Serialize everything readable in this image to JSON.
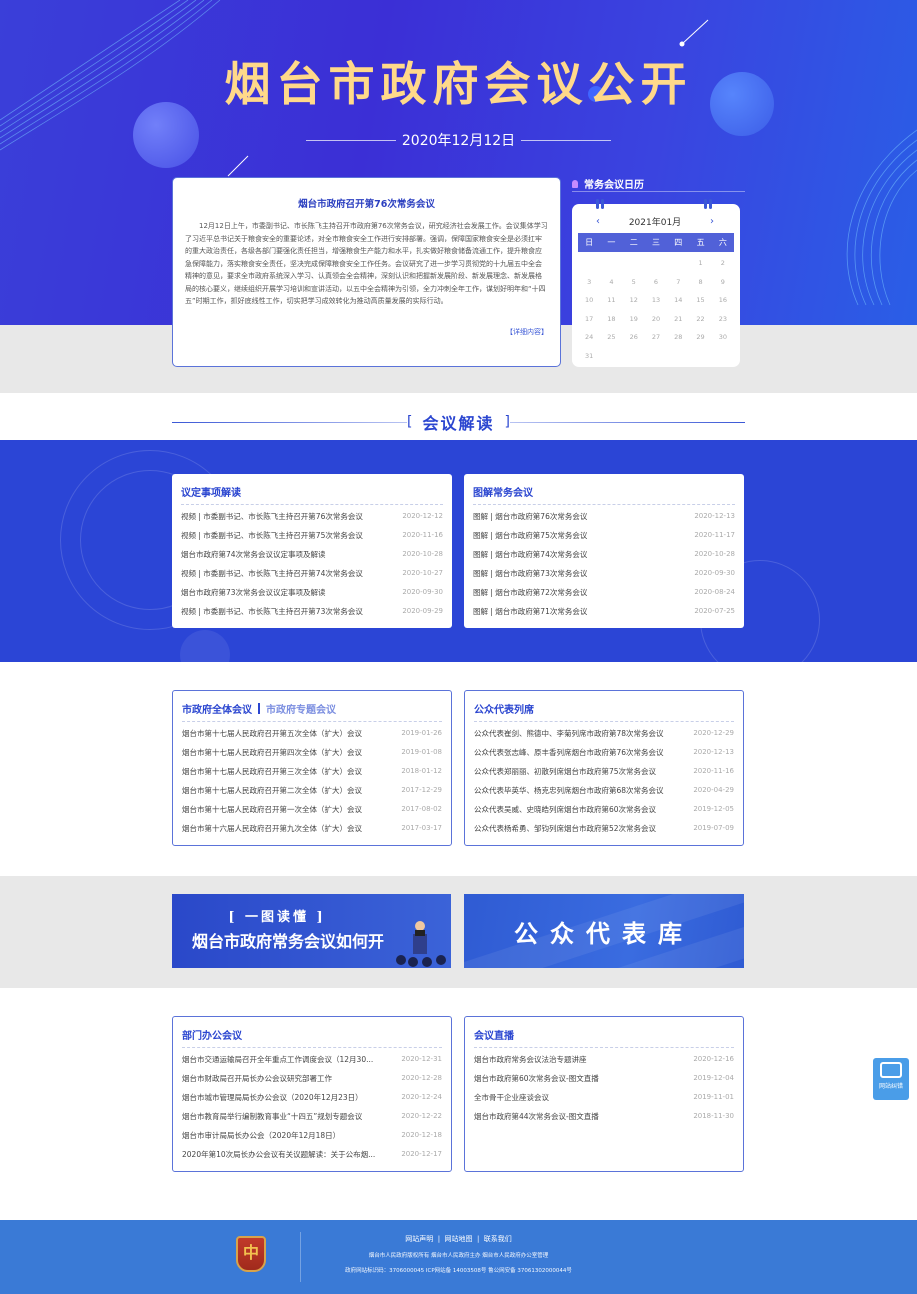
{
  "hero": {
    "title": "烟台市政府会议公开",
    "date": "2020年12月12日"
  },
  "feature": {
    "headline": "烟台市政府召开第76次常务会议",
    "body": "12月12日上午，市委副书记、市长陈飞主持召开市政府第76次常务会议，研究经济社会发展工作。会议集体学习了习近平总书记关于粮食安全的重要论述，对全市粮食安全工作进行安排部署。强调，保障国家粮食安全是必须扛牢的重大政治责任，各级各部门要强化责任担当，增强粮食生产能力和水平，扎实做好粮食储备流通工作，提升粮食应急保障能力，落实粮食安全责任，坚决完成保障粮食安全工作任务。会议研究了进一步学习贯彻党的十九届五中全会精神的意见，要求全市政府系统深入学习、认真领会全会精神，深刻认识和把握新发展阶段、新发展理念、新发展格局的核心要义，继续组织开展学习培训和宣讲活动，以五中全会精神为引领，全力冲刺全年工作，谋划好明年和“十四五”时期工作，抓好底线性工作，切实把学习成效转化为推动高质量发展的实际行动。",
    "more": "【详细内容】"
  },
  "calendar": {
    "heading": "常务会议日历",
    "month": "2021年01月",
    "prev": "‹",
    "next": "›",
    "weekdays": [
      "日",
      "一",
      "二",
      "三",
      "四",
      "五",
      "六"
    ],
    "days": [
      "",
      "",
      "",
      "",
      "",
      "1",
      "2",
      "3",
      "4",
      "5",
      "6",
      "7",
      "8",
      "9",
      "10",
      "11",
      "12",
      "13",
      "14",
      "15",
      "16",
      "17",
      "18",
      "19",
      "20",
      "21",
      "22",
      "23",
      "24",
      "25",
      "26",
      "27",
      "28",
      "29",
      "30",
      "31"
    ]
  },
  "section_title": "会议解读",
  "interpretation": {
    "title": "议定事项解读",
    "items": [
      {
        "t": "视频 | 市委副书记、市长陈飞主持召开第76次常务会议",
        "d": "2020-12-12"
      },
      {
        "t": "视频 | 市委副书记、市长陈飞主持召开第75次常务会议",
        "d": "2020-11-16"
      },
      {
        "t": "烟台市政府第74次常务会议议定事项及解读",
        "d": "2020-10-28"
      },
      {
        "t": "视频 | 市委副书记、市长陈飞主持召开第74次常务会议",
        "d": "2020-10-27"
      },
      {
        "t": "烟台市政府第73次常务会议议定事项及解读",
        "d": "2020-09-30"
      },
      {
        "t": "视频 | 市委副书记、市长陈飞主持召开第73次常务会议",
        "d": "2020-09-29"
      }
    ]
  },
  "graphic": {
    "title": "图解常务会议",
    "items": [
      {
        "t": "图解 | 烟台市政府第76次常务会议",
        "d": "2020-12-13"
      },
      {
        "t": "图解 | 烟台市政府第75次常务会议",
        "d": "2020-11-17"
      },
      {
        "t": "图解 | 烟台市政府第74次常务会议",
        "d": "2020-10-28"
      },
      {
        "t": "图解 | 烟台市政府第73次常务会议",
        "d": "2020-09-30"
      },
      {
        "t": "图解 | 烟台市政府第72次常务会议",
        "d": "2020-08-24"
      },
      {
        "t": "图解 | 烟台市政府第71次常务会议",
        "d": "2020-07-25"
      }
    ]
  },
  "plenary": {
    "tab_active": "市政府全体会议",
    "tab_other": "市政府专题会议",
    "items": [
      {
        "t": "烟台市第十七届人民政府召开第五次全体（扩大）会议",
        "d": "2019-01-26"
      },
      {
        "t": "烟台市第十七届人民政府召开第四次全体（扩大）会议",
        "d": "2019-01-08"
      },
      {
        "t": "烟台市第十七届人民政府召开第三次全体（扩大）会议",
        "d": "2018-01-12"
      },
      {
        "t": "烟台市第十七届人民政府召开第二次全体（扩大）会议",
        "d": "2017-12-29"
      },
      {
        "t": "烟台市第十七届人民政府召开第一次全体（扩大）会议",
        "d": "2017-08-02"
      },
      {
        "t": "烟台市第十六届人民政府召开第九次全体（扩大）会议",
        "d": "2017-03-17"
      }
    ]
  },
  "public_rep": {
    "title": "公众代表列席",
    "items": [
      {
        "t": "公众代表崔剑、熊德中、李菊列席市政府第78次常务会议",
        "d": "2020-12-29"
      },
      {
        "t": "公众代表张志峰、原丰香列席烟台市政府第76次常务会议",
        "d": "2020-12-13"
      },
      {
        "t": "公众代表郑丽丽、初散列席烟台市政府第75次常务会议",
        "d": "2020-11-16"
      },
      {
        "t": "公众代表毕英华、杨克忠列席烟台市政府第68次常务会议",
        "d": "2020-04-29"
      },
      {
        "t": "公众代表吴威、史晓皓列席烟台市政府第60次常务会议",
        "d": "2019-12-05"
      },
      {
        "t": "公众代表杨希勇、邹钧列席烟台市政府第52次常务会议",
        "d": "2019-07-09"
      }
    ]
  },
  "banners": {
    "left_small": "[ 一图读懂 ]",
    "left_big": "烟台市政府常务会议如何开",
    "right": "公众代表库"
  },
  "department": {
    "title": "部门办公会议",
    "items": [
      {
        "t": "烟台市交通运输局召开全年重点工作调度会议（12月30...",
        "d": "2020-12-31"
      },
      {
        "t": "烟台市财政局召开局长办公会议研究部署工作",
        "d": "2020-12-28"
      },
      {
        "t": "烟台市城市管理局局长办公会议（2020年12月23日）",
        "d": "2020-12-24"
      },
      {
        "t": "烟台市教育局举行编制教育事业“十四五”规划专题会议",
        "d": "2020-12-22"
      },
      {
        "t": "烟台市审计局局长办公会（2020年12月18日）",
        "d": "2020-12-18"
      },
      {
        "t": "2020年第10次局长办公会议有关议题解读：关于公布烟...",
        "d": "2020-12-17"
      }
    ]
  },
  "live": {
    "title": "会议直播",
    "items": [
      {
        "t": "烟台市政府常务会议法治专题讲座",
        "d": "2020-12-16"
      },
      {
        "t": "烟台市政府第60次常务会议-图文直播",
        "d": "2019-12-04"
      },
      {
        "t": "全市骨干企业座谈会议",
        "d": "2019-11-01"
      },
      {
        "t": "烟台市政府第44次常务会议-图文直播",
        "d": "2018-11-30"
      }
    ]
  },
  "float_button": "网站纠错",
  "footer": {
    "links": [
      "网站声明",
      "网站地图",
      "联系我们"
    ],
    "sep": "|",
    "line2": "烟台市人民政府版权所有   烟台市人民政府主办   烟台市人民政府办公室管理",
    "line3": "政府网站标识码：3706000045   ICP网站备 14003508号   鲁公网安备 37061302000044号",
    "logo_text": "中"
  },
  "colors": {
    "primary": "#2b45d6",
    "title_gold": "#ffd98a",
    "footer": "#3a7ad6"
  }
}
